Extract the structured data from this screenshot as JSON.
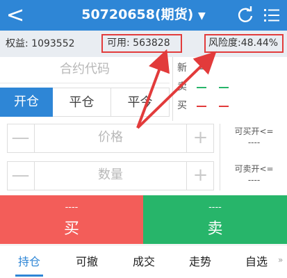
{
  "header": {
    "back_icon": "chevron-left-icon",
    "title": "50720658(期货)",
    "dropdown_icon": "caret-down-icon",
    "refresh_icon": "refresh-icon",
    "menu_icon": "menu-list-icon",
    "back_glyph": "<",
    "caret_glyph": "▼"
  },
  "infobar": {
    "equity": "权益: 1093552",
    "available": "可用: 563828",
    "risk": "风险度:48.44%"
  },
  "order": {
    "contract_placeholder": "合约代码",
    "tabs": [
      "开仓",
      "平仓",
      "平今"
    ],
    "price_placeholder": "价格",
    "quantity_placeholder": "数量",
    "minus_glyph": "—",
    "plus_glyph": "+"
  },
  "quote": {
    "labels": [
      "新",
      "卖",
      "买"
    ]
  },
  "side_info": {
    "can_buy_label": "可买开<=",
    "can_buy_value": "----",
    "can_sell_label": "可卖开<=",
    "can_sell_value": "----"
  },
  "actions": {
    "buy_value": "----",
    "buy_label": "买",
    "sell_value": "----",
    "sell_label": "卖"
  },
  "bottom_nav": {
    "items": [
      "持仓",
      "可撤",
      "成交",
      "走势",
      "自选"
    ],
    "more": "»"
  },
  "colors": {
    "primary": "#2e86d6",
    "buy": "#f35d59",
    "sell": "#27b56a",
    "highlight": "#e23b3b"
  }
}
